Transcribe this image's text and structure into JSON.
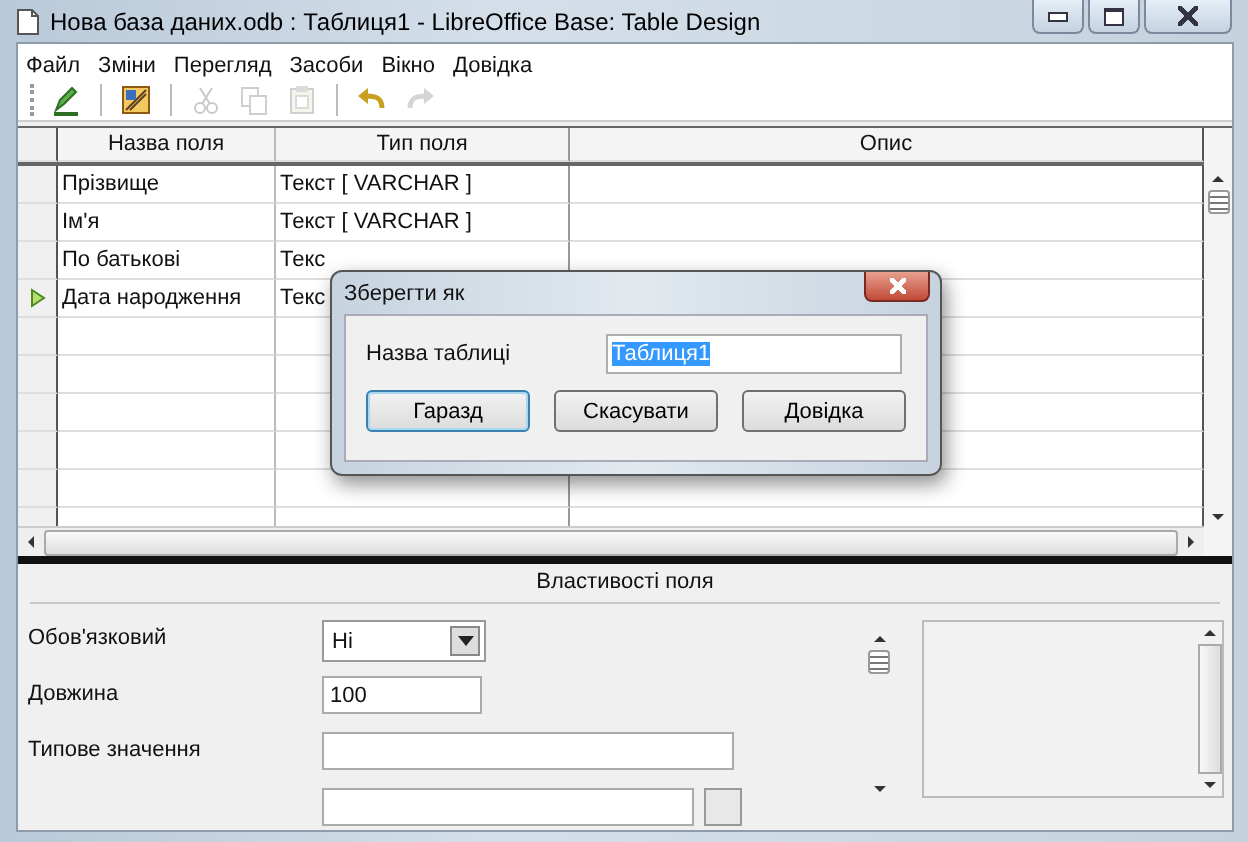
{
  "window": {
    "title": "Нова база даних.odb : Таблиця1 - LibreOffice Base: Table Design"
  },
  "menu": [
    "Файл",
    "Зміни",
    "Перегляд",
    "Засоби",
    "Вікно",
    "Довідка"
  ],
  "toolbar": [
    [
      {
        "kind": "edit",
        "disabled": false
      }
    ],
    [
      {
        "kind": "design",
        "disabled": false
      }
    ],
    [
      {
        "kind": "cut",
        "disabled": true
      },
      {
        "kind": "copy",
        "disabled": true
      },
      {
        "kind": "paste",
        "disabled": true
      }
    ],
    [
      {
        "kind": "undo",
        "disabled": false
      },
      {
        "kind": "redo",
        "disabled": true
      }
    ]
  ],
  "grid": {
    "columns": [
      "Назва поля",
      "Тип поля",
      "Опис"
    ],
    "rows": [
      {
        "name": "Прізвище",
        "type": "Текст [ VARCHAR ]",
        "current": false
      },
      {
        "name": "Ім'я",
        "type": "Текст [ VARCHAR ]",
        "current": false
      },
      {
        "name": "По батькові",
        "type": "Текс",
        "current": false
      },
      {
        "name": "Дата народження",
        "type": "Текс",
        "current": true
      }
    ]
  },
  "properties": {
    "title": "Властивості поля",
    "fields": [
      {
        "kind": "dropdown",
        "label": "Обов'язковий",
        "value": "Ні"
      },
      {
        "kind": "text",
        "label": "Довжина",
        "value": "100"
      },
      {
        "kind": "wide",
        "label": "Типове значення"
      },
      {
        "kind": "cutoff"
      }
    ]
  },
  "dialog": {
    "title": "Зберегти як",
    "label": "Назва таблиці",
    "value": "Таблиця1",
    "value_selected": true,
    "buttons": [
      {
        "label": "Гаразд",
        "default": true
      },
      {
        "label": "Скасувати",
        "default": false
      },
      {
        "label": "Довідка",
        "default": false
      }
    ]
  }
}
